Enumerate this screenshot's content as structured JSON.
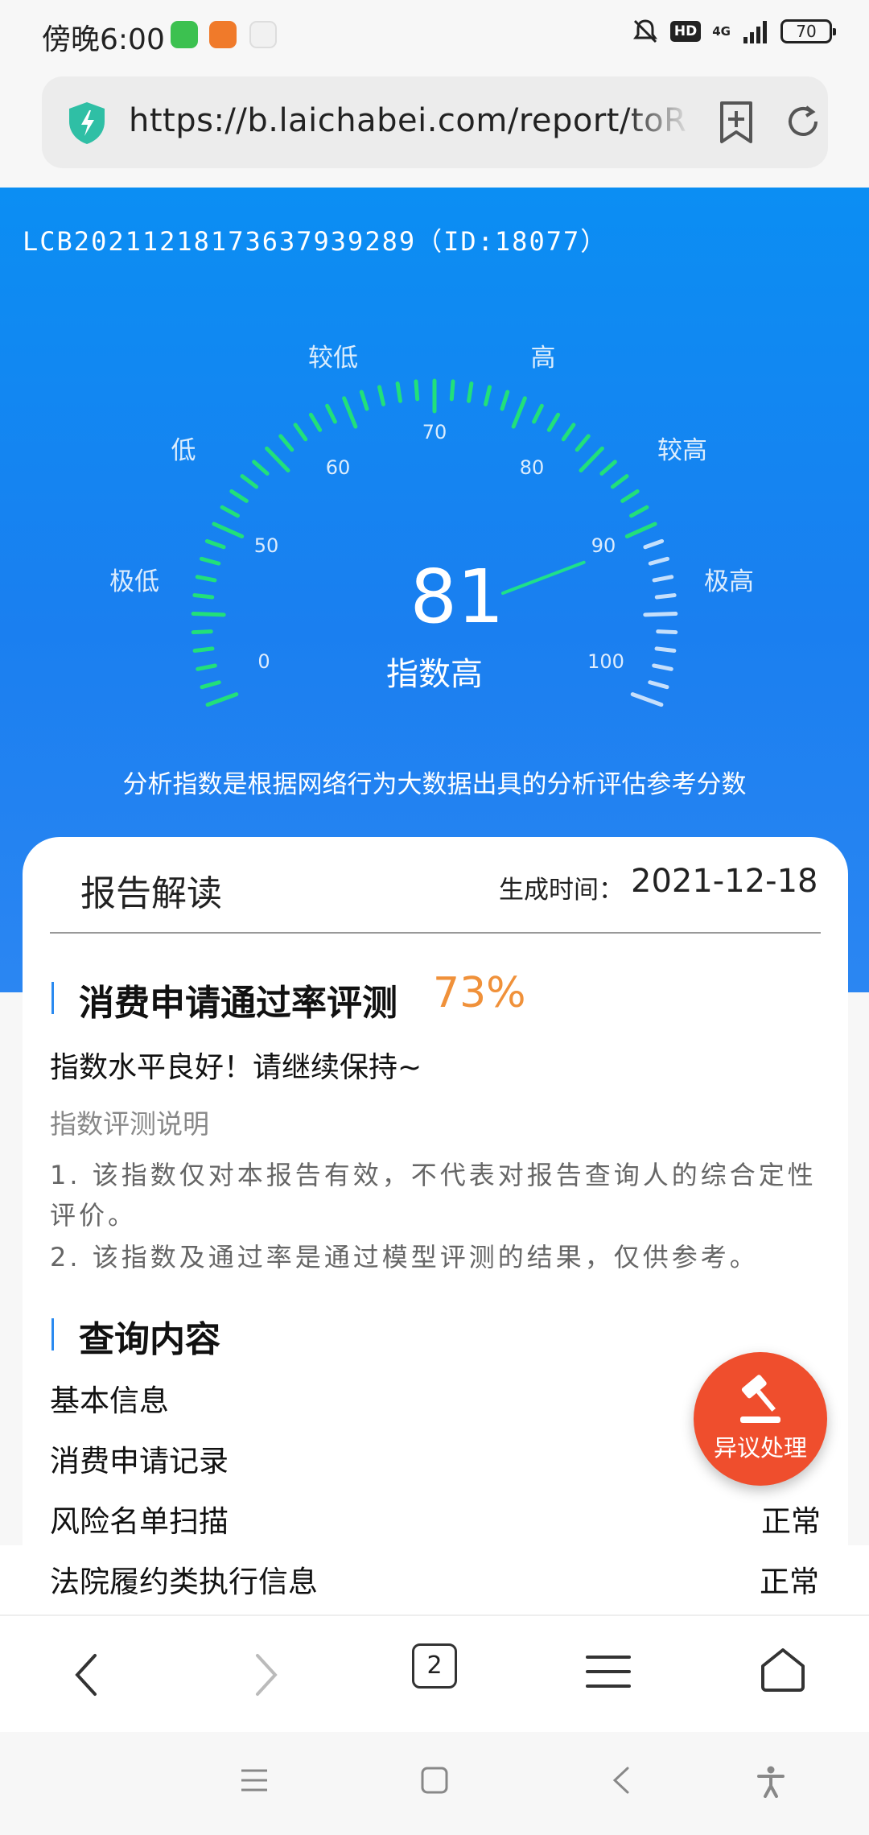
{
  "status_bar": {
    "time": "傍晚6:00",
    "hd": "HD",
    "network": "4G",
    "battery": "70",
    "icons": [
      "wechat-app-icon",
      "uc-browser-app-icon",
      "map-app-icon",
      "bell-muted-icon",
      "signal-icon",
      "battery-icon"
    ]
  },
  "url_bar": {
    "url": "https://b.laichabei.com/report/toR",
    "icons": [
      "shield-bolt-icon",
      "bookmark-add-icon",
      "reload-icon"
    ]
  },
  "hero": {
    "report_id": "LCB20211218173637939289（ID:18077）",
    "gauge": {
      "score": 81,
      "level_text": "指数高",
      "min": 0,
      "max": 100,
      "tick_labels": [
        "0",
        "50",
        "60",
        "70",
        "80",
        "90",
        "100"
      ],
      "zone_labels": [
        "极低",
        "低",
        "较低",
        "高",
        "较高",
        "极高"
      ]
    },
    "description": "分析指数是根据网络行为大数据出具的分析评估参考分数"
  },
  "report": {
    "title": "报告解读",
    "generated_label": "生成时间：",
    "generated_date": "2021-12-18",
    "pass_rate_section": {
      "title": "消费申请通过率评测",
      "rate": "73%",
      "comment": "指数水平良好！请继续保持~",
      "notes_title": "指数评测说明",
      "notes": [
        "1. 该指数仅对本报告有效，不代表对报告查询人的综合定性评价。",
        "2. 该指数及通过率是通过模型评测的结果，仅供参考。"
      ]
    },
    "query_section": {
      "title": "查询内容",
      "rows": [
        {
          "label": "基本信息",
          "value": ""
        },
        {
          "label": "消费申请记录",
          "value": ""
        },
        {
          "label": "风险名单扫描",
          "value": "正常"
        },
        {
          "label": "法院履约类执行信息",
          "value": "正常"
        }
      ]
    }
  },
  "dispute_button": {
    "label": "异议处理",
    "icon": "gavel-icon",
    "color": "#ef4e2d"
  },
  "browser_toolbar": {
    "tab_count": "2",
    "icons": [
      "back-icon",
      "forward-icon",
      "tabs-icon",
      "menu-icon",
      "home-icon"
    ]
  },
  "system_nav": {
    "icons": [
      "recents-icon",
      "home-square-icon",
      "back-triangle-icon",
      "accessibility-icon"
    ]
  },
  "colors": {
    "hero_blue": "#1a7ff0",
    "gauge_green": "#22e07a",
    "rate_orange": "#f0913a",
    "accent_blue": "#2a8af0"
  }
}
